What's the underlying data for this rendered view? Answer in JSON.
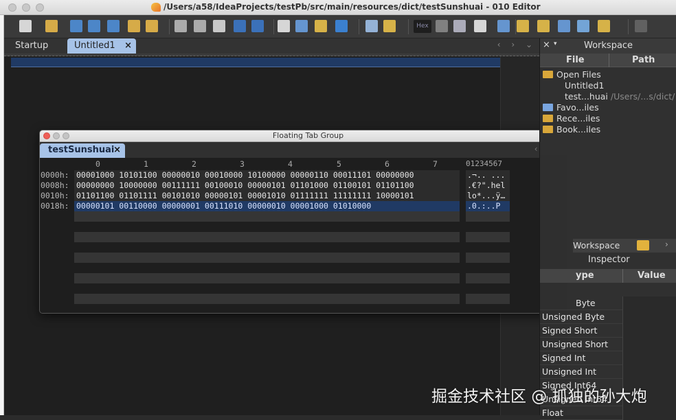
{
  "window": {
    "title": "/Users/a58/IdeaProjects/testPb/src/main/resources/dict/testSunshuai - 010 Editor"
  },
  "toolbar": {
    "hex_label": "Hex",
    "icons": [
      "new-file-icon",
      "open-icon",
      "save-icon",
      "save-as-icon",
      "save-all-icon",
      "open-folder-icon",
      "files-icon",
      "cut-icon",
      "copy-icon",
      "paste-icon",
      "undo-icon",
      "redo-icon",
      "find-icon",
      "replace-icon",
      "find-in-files-icon",
      "goto-icon",
      "compare-icon",
      "bookmark-icon",
      "hex-icon",
      "paragraph-icon",
      "columns-icon",
      "highlight-icon",
      "calculator-icon",
      "template-icon",
      "run-template-icon",
      "histogram-icon",
      "checksum-icon",
      "run-script-icon",
      "more-icon"
    ]
  },
  "main_tabs": [
    {
      "label": "Startup"
    },
    {
      "label": "Untitled1",
      "close": "×",
      "active": true
    }
  ],
  "tab_nav": "‹ › ⌄",
  "floating": {
    "title": "Floating Tab Group",
    "tab_label": "testSunshuai",
    "tab_close": "×",
    "columns": [
      "0",
      "1",
      "2",
      "3",
      "4",
      "5",
      "6",
      "7"
    ],
    "ascii_header": "01234567",
    "rows": [
      {
        "offset": "0000h:",
        "bytes": "00001000 10101100 00000010 00010000 10100000 00000110 00011101 00000000",
        "ascii": ".¬.. ..."
      },
      {
        "offset": "0008h:",
        "bytes": "00000000 10000000 00111111 00100010 00000101 01101000 01100101 01101100",
        "ascii": ".€?\".hel"
      },
      {
        "offset": "0010h:",
        "bytes": "01101100 01101111 00101010 00000101 00001010 01111111 11111111 10000101",
        "ascii": "lo*...ÿ…"
      },
      {
        "offset": "0018h:",
        "bytes": "00000101 00110000 00000001 00111010 00000010 00001000 01010000",
        "ascii": ".0.:..P",
        "selected": true
      }
    ]
  },
  "workspace": {
    "title": "Workspace",
    "close": "×",
    "menu": "▾",
    "col_file": "File",
    "col_path": "Path",
    "open_files": "Open Files",
    "files": [
      {
        "name": "Untitled1",
        "path": ""
      },
      {
        "name": "test...huai",
        "path": "/Users/...s/dict/"
      }
    ],
    "favorites": "Favo...iles",
    "recent": "Rece...iles",
    "bookmarks": "Book...iles"
  },
  "inspector": {
    "tab_workspace": "Workspace",
    "title": "Inspector",
    "col_type": "ype",
    "col_value": "Value",
    "rows": [
      "Byte",
      "Unsigned Byte",
      "Signed Short",
      "Unsigned Short",
      "Signed Int",
      "Unsigned Int",
      "Signed Int64",
      "Unsigned Int64",
      "Float"
    ]
  },
  "watermark": "掘金技术社区 @ 抓独的孙大炮"
}
